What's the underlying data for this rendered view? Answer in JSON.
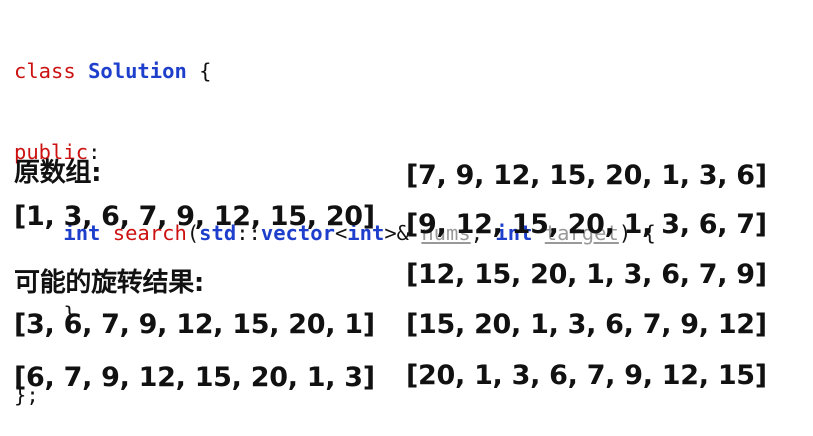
{
  "code": {
    "line1": {
      "kw": "class",
      "name": "Solution",
      "brace": "{"
    },
    "line2": {
      "kw": "public",
      "colon": ":"
    },
    "line3": {
      "ret": "int",
      "fn": "search",
      "open": "(",
      "ns": "std",
      "sep": "::",
      "type": "vector",
      "lt": "<",
      "inner": "int",
      "gt_amp": ">&",
      "p1": "nums",
      "comma": ",",
      "ret2": "int",
      "p2": "target",
      "close": ")",
      "brace": "{"
    },
    "line4": "}",
    "line5": "};"
  },
  "left": {
    "original_heading": "原数组:",
    "original": "[1, 3, 6, 7, 9, 12, 15, 20]",
    "rotations_heading": "可能的旋转结果:",
    "rotations": [
      "[3, 6, 7, 9, 12, 15, 20, 1]",
      "[6, 7, 9, 12, 15, 20, 1, 3]"
    ]
  },
  "right": {
    "rotations": [
      "[7, 9, 12, 15, 20, 1, 3, 6]",
      "[9, 12, 15, 20, 1, 3, 6, 7]",
      "[12, 15, 20, 1, 3, 6, 7, 9]",
      "[15, 20, 1, 3, 6, 7, 9, 12]",
      "[20, 1, 3, 6, 7, 9, 12, 15]"
    ]
  }
}
